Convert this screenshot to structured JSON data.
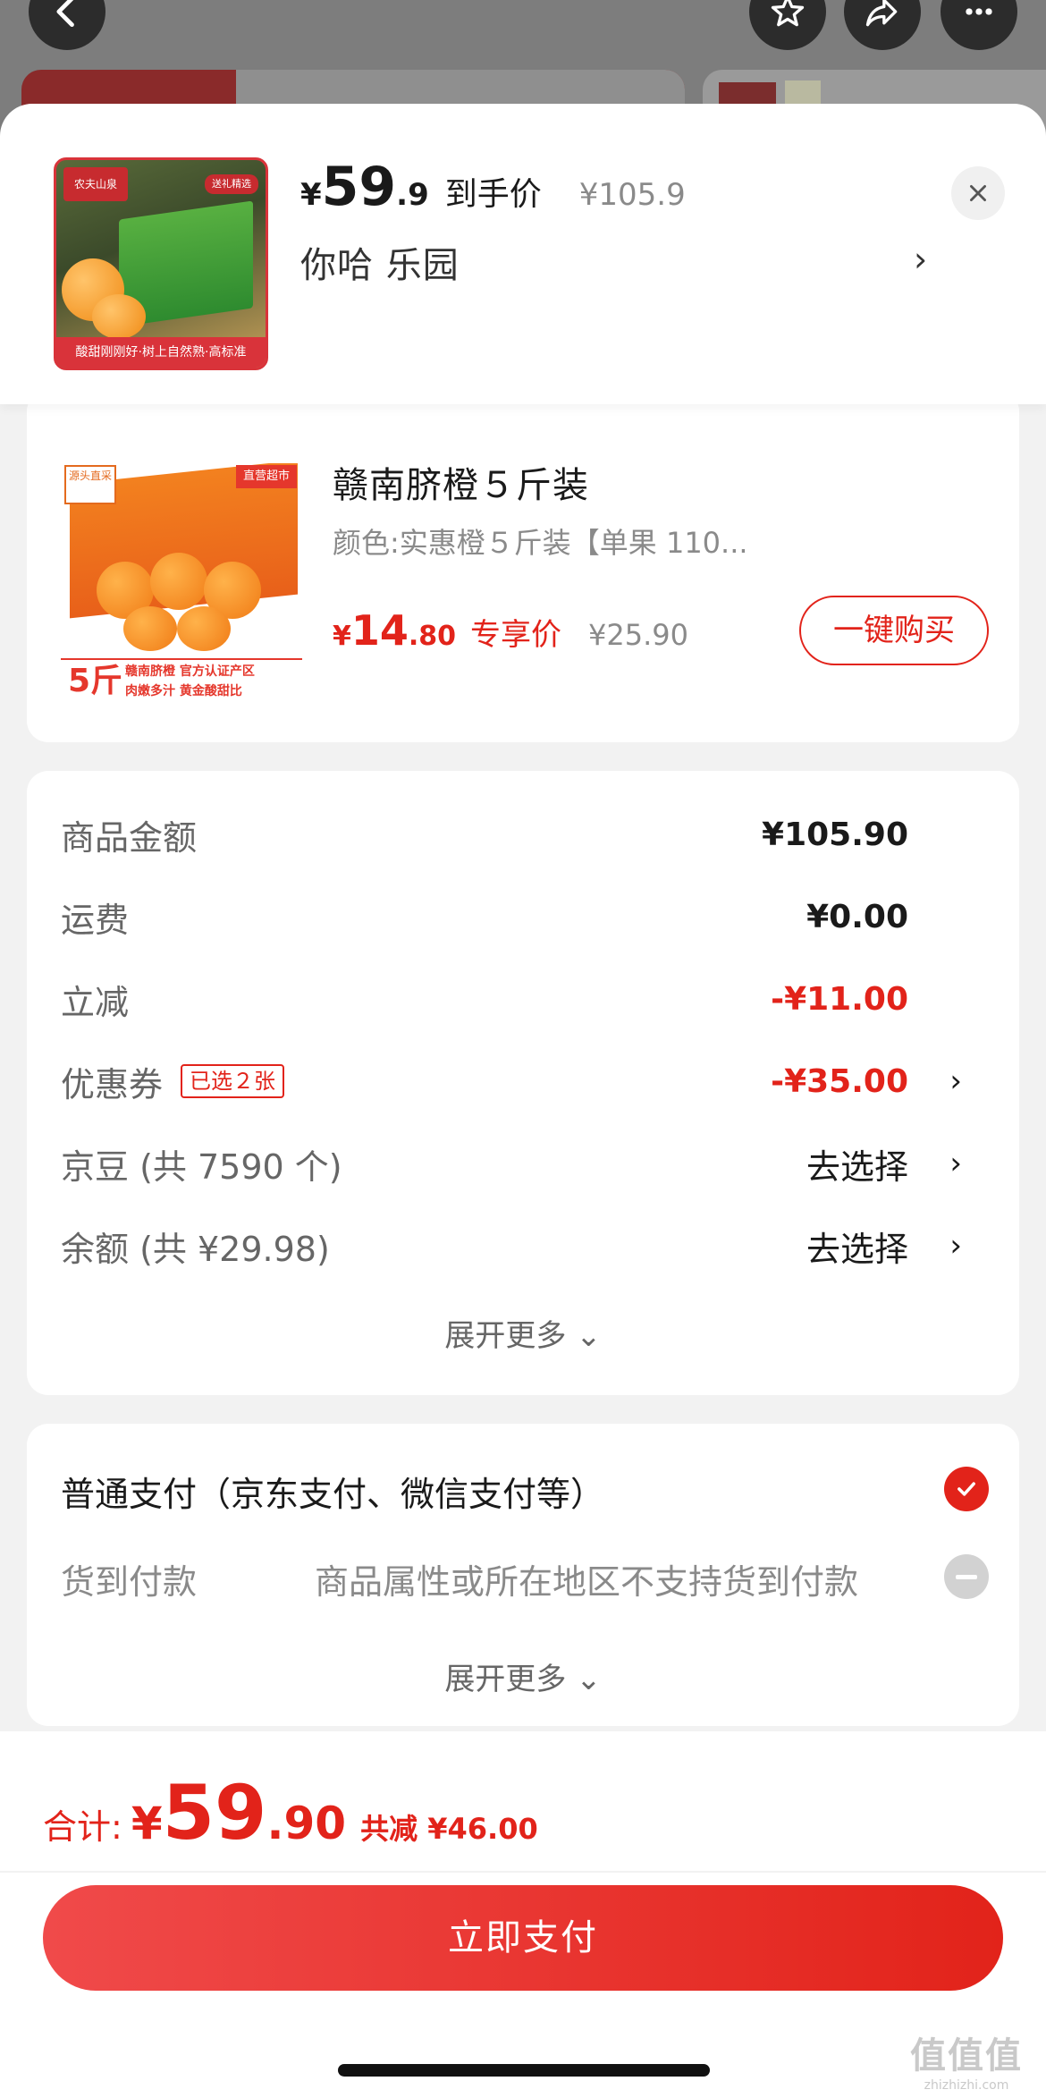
{
  "header": {
    "back_icon": "chevron-left-icon",
    "favorite_icon": "star-icon",
    "share_icon": "share-arrow-icon",
    "more_icon": "more-dots-icon"
  },
  "top_panel": {
    "currency": "¥",
    "price_int": "59",
    "price_dec": ".9",
    "price_label": "到手价",
    "original_price": "¥105.9",
    "address": "你哈  乐园",
    "address_chevron": "›",
    "close_icon": "close-icon",
    "thumb": {
      "brand": "农夫山泉",
      "tag": "送礼精选",
      "strip": "酸甜刚刚好·树上自然熟·高标准"
    }
  },
  "product": {
    "title": "赣南脐橙５斤装",
    "spec": "颜色:实惠橙５斤装【单果 110...",
    "currency": "¥",
    "price_int": "14",
    "price_dec": ".80",
    "price_label": "专享价",
    "original_price": "¥25.90",
    "buy_button": "一键购买",
    "thumb": {
      "chip": "源头直采",
      "chip2": "直营超市",
      "foot1": "赣南脐橙 官方认证产区",
      "foot2": "肉嫩多汁 黄金酸甜比",
      "five": "5斤"
    }
  },
  "summary": {
    "rows": [
      {
        "label": "商品金额",
        "value": "¥105.90"
      },
      {
        "label": "运费",
        "value": "¥0.00"
      },
      {
        "label": "立减",
        "value": "-¥11.00"
      },
      {
        "label": "优惠券",
        "tag": "已选２张",
        "value": "-¥35.00",
        "chevron": "›"
      },
      {
        "label": "京豆 (共 7590 个)",
        "value": "去选择",
        "chevron": "›"
      },
      {
        "label": "余额 (共 ¥29.98)",
        "value": "去选择",
        "chevron": "›"
      }
    ],
    "expand": "展开更多 ⌄"
  },
  "payment": {
    "option1": "普通支付（京东支付、微信支付等）",
    "option2_label": "货到付款",
    "option2_note": "商品属性或所在地区不支持货到付款",
    "expand": "展开更多 ⌄",
    "check_icon": "check-circle-icon",
    "disabled_icon": "minus-circle-icon"
  },
  "bottom": {
    "total_label": "合计:",
    "currency": "¥",
    "total_int": "59",
    "total_dec": ".90",
    "savings": "共减 ¥46.00",
    "pay_button": "立即支付",
    "watermark1": "值值值",
    "watermark2": "zhizhizhi.com"
  },
  "colors": {
    "accent": "#e2231a",
    "text": "#1a1a1a",
    "muted": "#8a8a8a"
  }
}
